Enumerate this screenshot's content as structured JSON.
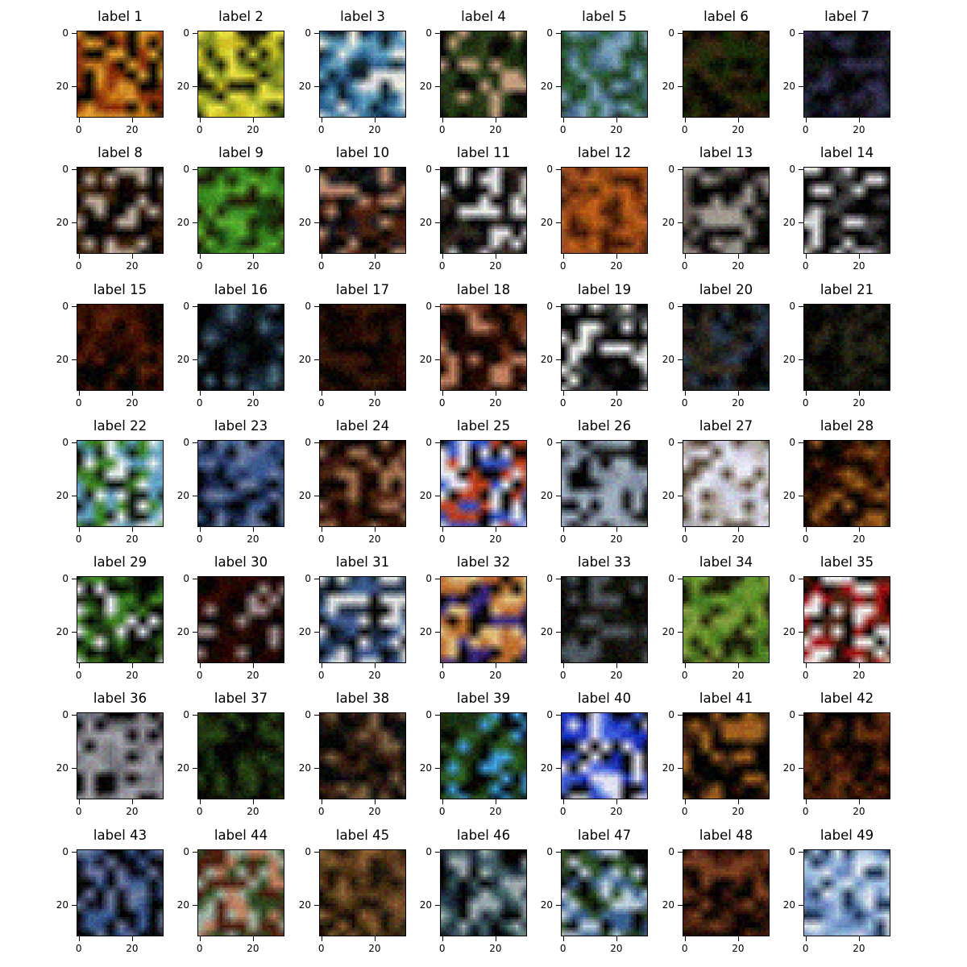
{
  "figure": {
    "panels": [
      {
        "title": "label 1",
        "palette": [
          "#000000",
          "#8a2e0a",
          "#c87a1a",
          "#e0a030"
        ]
      },
      {
        "title": "label 2",
        "palette": [
          "#c8c020",
          "#e8e040",
          "#101008",
          "#7a8a20"
        ]
      },
      {
        "title": "label 3",
        "palette": [
          "#2a6090",
          "#e8e8e0",
          "#10202a",
          "#60a0c0"
        ]
      },
      {
        "title": "label 4",
        "palette": [
          "#000000",
          "#1a2a10",
          "#2a4018",
          "#c8a080"
        ]
      },
      {
        "title": "label 5",
        "palette": [
          "#4a7090",
          "#7aa0b8",
          "#1a3a20",
          "#2a5a30"
        ]
      },
      {
        "title": "label 6",
        "palette": [
          "#000000",
          "#201808",
          "#3a2810",
          "#1a2a08"
        ]
      },
      {
        "title": "label 7",
        "palette": [
          "#000000",
          "#10101a",
          "#303050",
          "#181818"
        ]
      },
      {
        "title": "label 8",
        "palette": [
          "#000000",
          "#180a00",
          "#3a2008",
          "#c0b0a0"
        ]
      },
      {
        "title": "label 9",
        "palette": [
          "#3a8a20",
          "#1a4010",
          "#5ab030",
          "#201808"
        ]
      },
      {
        "title": "label 10",
        "palette": [
          "#000000",
          "#4a2010",
          "#c09070",
          "#1a1a20"
        ]
      },
      {
        "title": "label 11",
        "palette": [
          "#000000",
          "#e8e8e8",
          "#302820",
          "#101010"
        ]
      },
      {
        "title": "label 12",
        "palette": [
          "#8a4010",
          "#c06018",
          "#401808",
          "#a05020"
        ]
      },
      {
        "title": "label 13",
        "palette": [
          "#000000",
          "#706860",
          "#a09890",
          "#101010"
        ]
      },
      {
        "title": "label 14",
        "palette": [
          "#000000",
          "#e0e0e0",
          "#404040",
          "#000000"
        ]
      },
      {
        "title": "label 15",
        "palette": [
          "#000000",
          "#3a1000",
          "#5a2008",
          "#200800"
        ]
      },
      {
        "title": "label 16",
        "palette": [
          "#000000",
          "#1a2a3a",
          "#4a6a7a",
          "#101820"
        ]
      },
      {
        "title": "label 17",
        "palette": [
          "#000000",
          "#200800",
          "#3a1808",
          "#100400"
        ]
      },
      {
        "title": "label 18",
        "palette": [
          "#000000",
          "#200800",
          "#6a3018",
          "#c08060"
        ]
      },
      {
        "title": "label 19",
        "palette": [
          "#000000",
          "#f0f0f0",
          "#3a3a3a",
          "#000000"
        ]
      },
      {
        "title": "label 20",
        "palette": [
          "#000000",
          "#1a1a18",
          "#3a3020",
          "#2a3a50"
        ]
      },
      {
        "title": "label 21",
        "palette": [
          "#000000",
          "#101008",
          "#282818",
          "#000000"
        ]
      },
      {
        "title": "label 22",
        "palette": [
          "#60a0c0",
          "#e8f0f0",
          "#101810",
          "#3a8020"
        ]
      },
      {
        "title": "label 23",
        "palette": [
          "#1a2a50",
          "#3a5a90",
          "#000000",
          "#6a7aa0"
        ]
      },
      {
        "title": "label 24",
        "palette": [
          "#000000",
          "#4a2010",
          "#a07050",
          "#200800"
        ]
      },
      {
        "title": "label 25",
        "palette": [
          "#3050c0",
          "#e8e8f0",
          "#000000",
          "#c04020"
        ]
      },
      {
        "title": "label 26",
        "palette": [
          "#8090a0",
          "#a0b0c0",
          "#000000",
          "#1a1a1a"
        ]
      },
      {
        "title": "label 27",
        "palette": [
          "#d0d0e0",
          "#b0a8a0",
          "#e8e8f0",
          "#504030"
        ]
      },
      {
        "title": "label 28",
        "palette": [
          "#000000",
          "#5a2808",
          "#a06020",
          "#200800"
        ]
      },
      {
        "title": "label 29",
        "palette": [
          "#000000",
          "#3a8020",
          "#e8e8f0",
          "#1a3010"
        ]
      },
      {
        "title": "label 30",
        "palette": [
          "#000000",
          "#300800",
          "#a09090",
          "#180400"
        ]
      },
      {
        "title": "label 31",
        "palette": [
          "#000000",
          "#3a5a90",
          "#e0e0e0",
          "#1a2a40"
        ]
      },
      {
        "title": "label 32",
        "palette": [
          "#3a2a80",
          "#c07030",
          "#000000",
          "#e0c080"
        ]
      },
      {
        "title": "label 33",
        "palette": [
          "#000000",
          "#1a1a18",
          "#505a60",
          "#101008"
        ]
      },
      {
        "title": "label 34",
        "palette": [
          "#4a7a20",
          "#6a9a30",
          "#1a1808",
          "#8aa040"
        ]
      },
      {
        "title": "label 35",
        "palette": [
          "#000000",
          "#a01010",
          "#f0f0f0",
          "#4a2010"
        ]
      },
      {
        "title": "label 36",
        "palette": [
          "#8a8a90",
          "#a0a0a8",
          "#000000",
          "#707078"
        ]
      },
      {
        "title": "label 37",
        "palette": [
          "#000000",
          "#1a3010",
          "#2a4a18",
          "#101008"
        ]
      },
      {
        "title": "label 38",
        "palette": [
          "#000000",
          "#3a2010",
          "#7a6040",
          "#101010"
        ]
      },
      {
        "title": "label 39",
        "palette": [
          "#40a0e0",
          "#1a3010",
          "#000000",
          "#2a5a20"
        ]
      },
      {
        "title": "label 40",
        "palette": [
          "#1a30c0",
          "#e0e0f0",
          "#000000",
          "#4060e0"
        ]
      },
      {
        "title": "label 41",
        "palette": [
          "#000000",
          "#a06020",
          "#3a2010",
          "#000000"
        ]
      },
      {
        "title": "label 42",
        "palette": [
          "#000000",
          "#3a1808",
          "#6a3010",
          "#100400"
        ]
      },
      {
        "title": "label 43",
        "palette": [
          "#000000",
          "#3a5a90",
          "#6a7aa0",
          "#101020"
        ]
      },
      {
        "title": "label 44",
        "palette": [
          "#a0b0a0",
          "#4a2010",
          "#2a4a20",
          "#c08060"
        ]
      },
      {
        "title": "label 45",
        "palette": [
          "#4a3010",
          "#8a6030",
          "#1a1008",
          "#604020"
        ]
      },
      {
        "title": "label 46",
        "palette": [
          "#1a2a3a",
          "#a0b0b0",
          "#000000",
          "#3a5a60"
        ]
      },
      {
        "title": "label 47",
        "palette": [
          "#2a4a20",
          "#c0d0e0",
          "#000000",
          "#3a6090"
        ]
      },
      {
        "title": "label 48",
        "palette": [
          "#000000",
          "#4a2010",
          "#7a4020",
          "#100400"
        ]
      },
      {
        "title": "label 49",
        "palette": [
          "#6a8ac0",
          "#a0c0e0",
          "#1a3050",
          "#e0e8f0"
        ]
      }
    ],
    "y_ticks": [
      "0",
      "20"
    ],
    "x_ticks": [
      "0",
      "20"
    ]
  }
}
